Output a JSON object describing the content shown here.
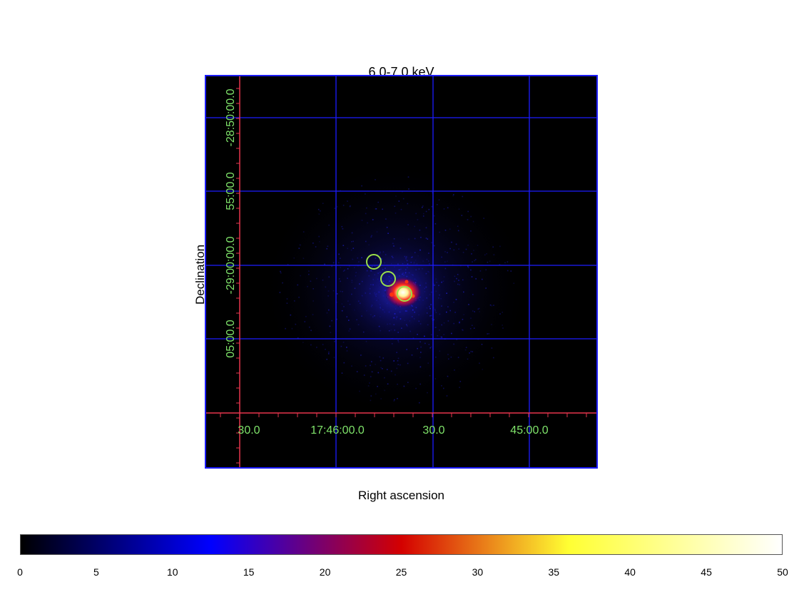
{
  "title": "6.0-7.0 keV",
  "axes": {
    "x_label": "Right ascension",
    "y_label": "Declination",
    "ra_ticks": [
      "30.0",
      "17:46:00.0",
      "30.0",
      "45:00.0"
    ],
    "dec_ticks": [
      "-28:50:00.0",
      "55:00.0",
      "-29:00:00.0",
      "05:00.0"
    ]
  },
  "colorbar": {
    "ticks": [
      "0",
      "5",
      "10",
      "15",
      "20",
      "25",
      "30",
      "35",
      "40",
      "45",
      "50"
    ],
    "range": [
      0,
      50
    ],
    "colors": [
      "#000000",
      "#0000ff",
      "#d40000",
      "#ffff33",
      "#ffffff"
    ]
  },
  "colors": {
    "grid": "#1c1cff",
    "ticks": "#e8364e",
    "labels": "#7fe36a",
    "regions": "#9be04a",
    "background": "#000000"
  },
  "regions": [
    {
      "shape": "circle"
    },
    {
      "shape": "circle"
    },
    {
      "shape": "circle"
    }
  ]
}
